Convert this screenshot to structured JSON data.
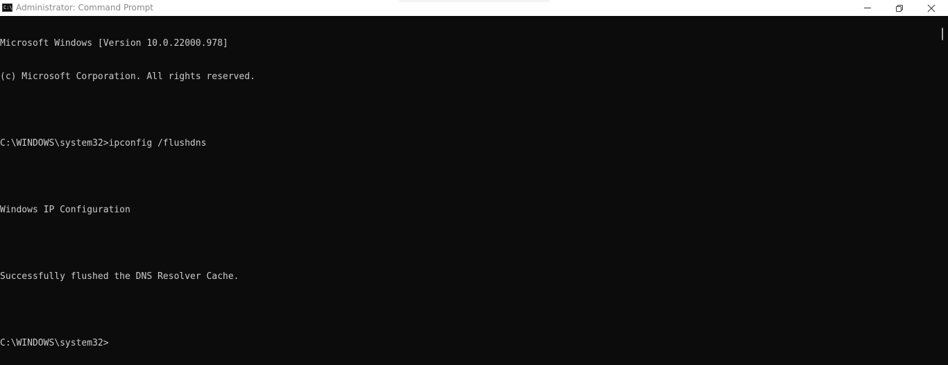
{
  "window": {
    "title": "Administrator: Command Prompt",
    "icon": "cmd-icon",
    "icon_text": "C:\\"
  },
  "controls": {
    "minimize_icon": "minimize-icon",
    "restore_icon": "restore-icon",
    "close_icon": "close-icon"
  },
  "console": {
    "background": "#0c0c0c",
    "foreground": "#cccccc",
    "lines": [
      "Microsoft Windows [Version 10.0.22000.978]",
      "(c) Microsoft Corporation. All rights reserved.",
      "",
      "C:\\WINDOWS\\system32>ipconfig /flushdns",
      "",
      "Windows IP Configuration",
      "",
      "Successfully flushed the DNS Resolver Cache.",
      "",
      "C:\\WINDOWS\\system32>"
    ]
  }
}
